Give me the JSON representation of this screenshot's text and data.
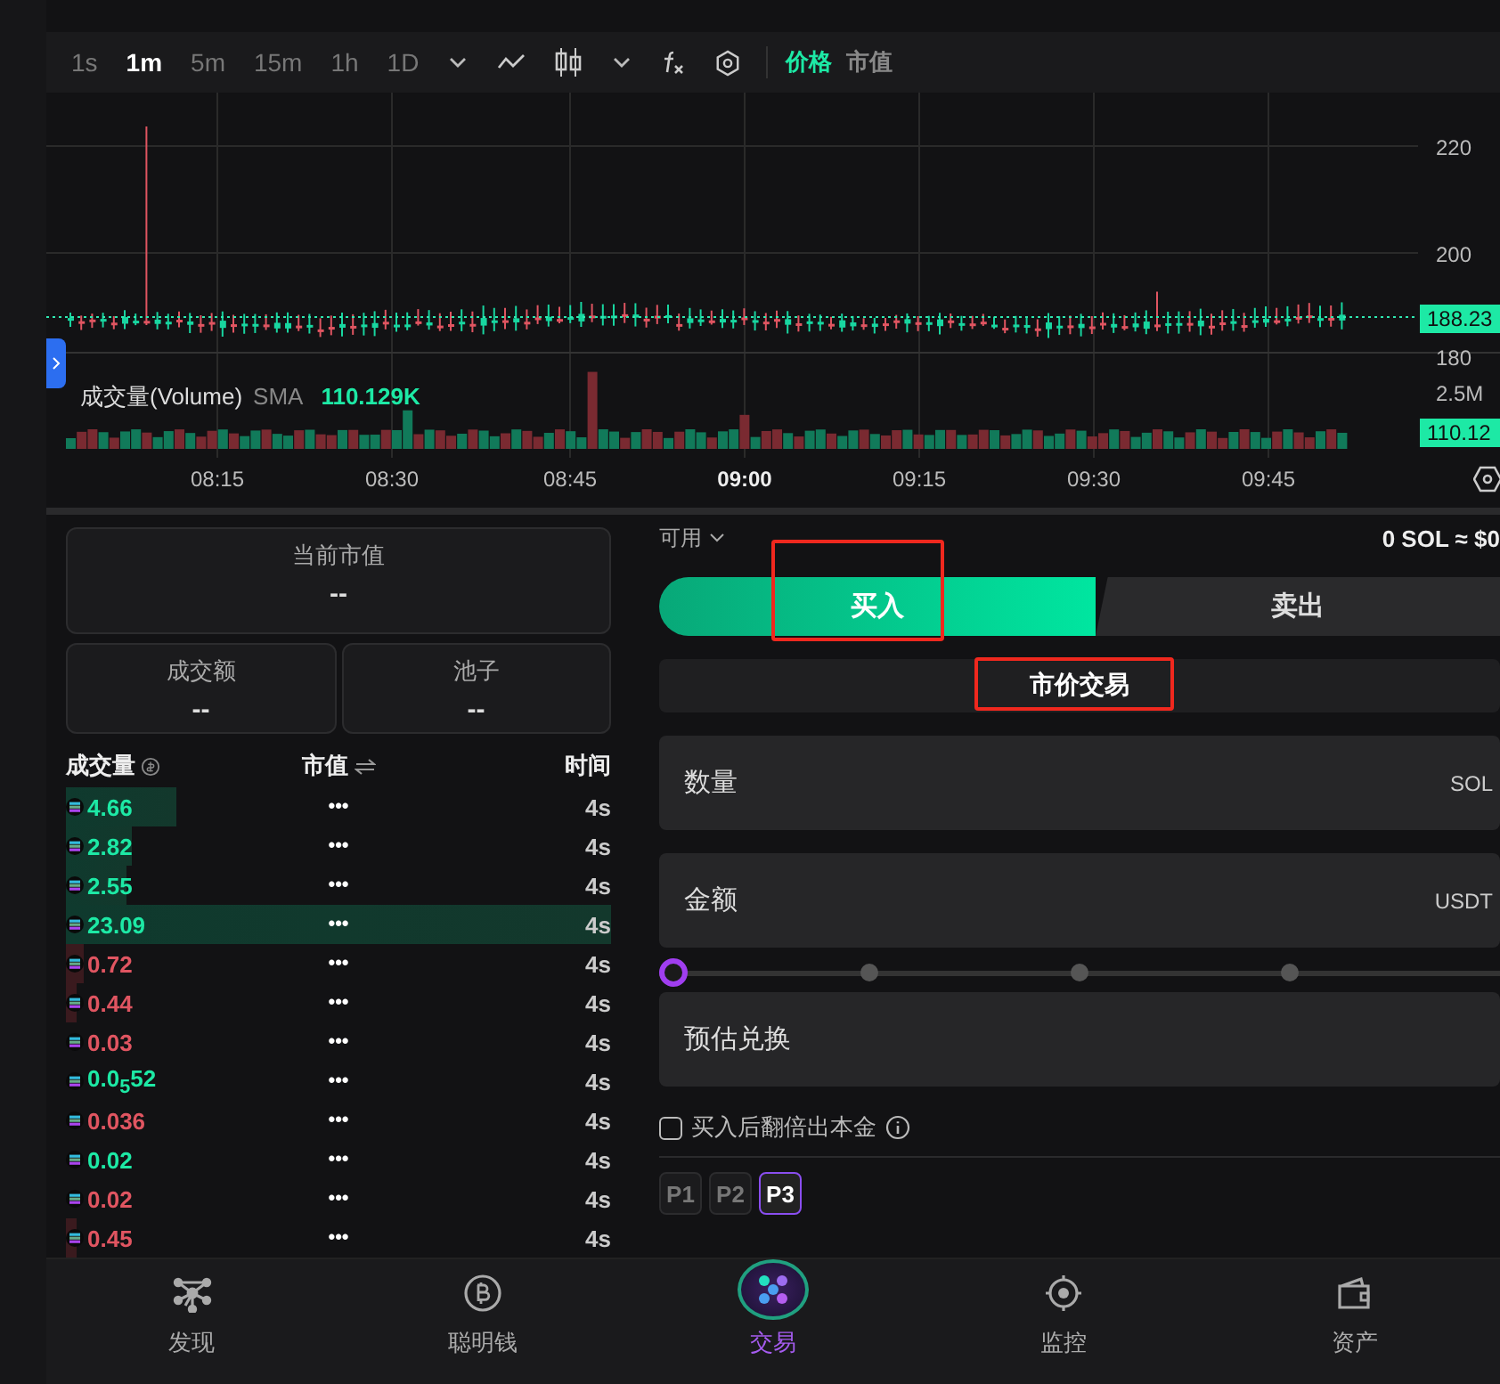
{
  "toolbar": {
    "intervals": [
      {
        "label": "1s",
        "selected": false
      },
      {
        "label": "1m",
        "selected": true
      },
      {
        "label": "5m",
        "selected": false
      },
      {
        "label": "15m",
        "selected": false
      },
      {
        "label": "1h",
        "selected": false
      },
      {
        "label": "1D",
        "selected": false
      }
    ],
    "modes": [
      {
        "label": "价格",
        "selected": true
      },
      {
        "label": "市值",
        "selected": false
      }
    ]
  },
  "chart": {
    "price_ticks": [
      "220",
      "200",
      "180"
    ],
    "last_price": "188.23",
    "volume_tick": "2.5M",
    "last_volume": "110.12",
    "volume_label": "成交量(Volume)",
    "volume_sma": "SMA",
    "volume_value": "110.129K",
    "time_ticks": [
      "08:15",
      "08:30",
      "08:45",
      "09:00",
      "09:15",
      "09:30",
      "09:45"
    ]
  },
  "stats": {
    "market_cap": {
      "label": "当前市值",
      "value": "--"
    },
    "turnover": {
      "label": "成交额",
      "value": "--"
    },
    "pool": {
      "label": "池子",
      "value": "--"
    }
  },
  "trades": {
    "columns": [
      "成交量",
      "市值",
      "时间"
    ],
    "rows": [
      {
        "amount": "4.66",
        "kind": "buy",
        "market_value": "•••",
        "time": "4s"
      },
      {
        "amount": "2.82",
        "kind": "buy",
        "market_value": "•••",
        "time": "4s"
      },
      {
        "amount": "2.55",
        "kind": "buy",
        "market_value": "•••",
        "time": "4s"
      },
      {
        "amount": "23.09",
        "kind": "buy",
        "market_value": "•••",
        "time": "4s"
      },
      {
        "amount": "0.72",
        "kind": "sell",
        "market_value": "•••",
        "time": "4s"
      },
      {
        "amount": "0.44",
        "kind": "sell",
        "market_value": "•••",
        "time": "4s"
      },
      {
        "amount": "0.03",
        "kind": "sell",
        "market_value": "•••",
        "time": "4s"
      },
      {
        "amount": "0.0$_{5}$52",
        "kind": "buy",
        "market_value": "•••",
        "time": "4s"
      },
      {
        "amount": "0.036",
        "kind": "sell",
        "market_value": "•••",
        "time": "4s"
      },
      {
        "amount": "0.02",
        "kind": "buy",
        "market_value": "•••",
        "time": "4s"
      },
      {
        "amount": "0.02",
        "kind": "sell",
        "market_value": "•••",
        "time": "4s"
      },
      {
        "amount": "0.45",
        "kind": "sell",
        "market_value": "•••",
        "time": "4s"
      }
    ]
  },
  "order": {
    "available_label": "可用",
    "balance": "0 SOL ≈ $0",
    "sides": [
      {
        "label": "买入",
        "selected": true,
        "highlighted": true
      },
      {
        "label": "卖出",
        "selected": false,
        "highlighted": false
      }
    ],
    "order_type": {
      "label": "市价交易",
      "highlighted": true
    },
    "fields": [
      {
        "label": "数量",
        "unit": "SOL"
      },
      {
        "label": "金额",
        "unit": "USDT"
      }
    ],
    "slider": {
      "level": 0
    },
    "estimate": {
      "label": "预估兑换"
    },
    "double_exit": {
      "label": "买入后翻倍出本金",
      "checked": false
    },
    "presets": [
      {
        "label": "P1",
        "selected": false
      },
      {
        "label": "P2",
        "selected": false
      },
      {
        "label": "P3",
        "selected": true
      }
    ]
  },
  "nav": [
    {
      "label": "发现",
      "selected": false
    },
    {
      "label": "聪明钱",
      "selected": false
    },
    {
      "label": "交易",
      "selected": true
    },
    {
      "label": "监控",
      "selected": false
    },
    {
      "label": "资产",
      "selected": false
    }
  ]
}
